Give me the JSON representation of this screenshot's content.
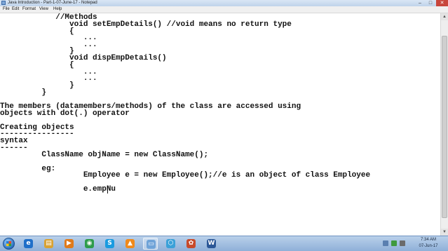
{
  "window": {
    "title": "Java Introduction - Part-1-07-June-17 - Notepad",
    "controls": {
      "minimize": "–",
      "maximize": "□",
      "close": "✕"
    }
  },
  "menu": {
    "items": [
      "File",
      "Edit",
      "Format",
      "View",
      "Help"
    ]
  },
  "editor": {
    "lines": [
      {
        "text": "            //Methods"
      },
      {
        "text": "               void setEmpDetails() //void means no return type"
      },
      {
        "text": "               {"
      },
      {
        "text": "                  ..."
      },
      {
        "text": "                  ..."
      },
      {
        "text": "               }"
      },
      {
        "text": "               void dispEmpDetails()"
      },
      {
        "text": "               {"
      },
      {
        "text": "                  ..."
      },
      {
        "text": "                  ..."
      },
      {
        "text": "               }"
      },
      {
        "text": "         }"
      },
      {
        "text": "The members (datamembers/methods) of the class are accessed using"
      },
      {
        "text": "objects with dot(.) operator"
      },
      {
        "text": ""
      },
      {
        "text": "Creating objects"
      },
      {
        "text": "----------------"
      },
      {
        "text": "syntax"
      },
      {
        "text": "------"
      },
      {
        "text": "         ClassName objName = new ClassName();"
      },
      {
        "text": ""
      },
      {
        "text": "         eg:"
      },
      {
        "text": "                  Employee e = new Employee();//e is an object of class Employee"
      },
      {
        "text": ""
      },
      {
        "text": "                  e.empNu"
      }
    ]
  },
  "scrollbar": {
    "up": "▲",
    "down": "▼"
  },
  "taskbar": {
    "buttons": [
      {
        "icon": "ie-icon",
        "glyph": "e",
        "color": "#1f6fc9"
      },
      {
        "icon": "explorer-icon",
        "glyph": "▤",
        "color": "#d9a233"
      },
      {
        "icon": "media-player-icon",
        "glyph": "▶",
        "color": "#e07a1a"
      },
      {
        "icon": "chrome-icon",
        "glyph": "◉",
        "color": "#2e9c4a"
      },
      {
        "icon": "skype-icon",
        "glyph": "S",
        "color": "#1a9be0"
      },
      {
        "icon": "vlc-icon",
        "glyph": "▲",
        "color": "#f08a1c"
      },
      {
        "icon": "notepad-icon",
        "glyph": "▭",
        "color": "#6fa3d8"
      },
      {
        "icon": "network-icon",
        "glyph": "⬡",
        "color": "#3aa1d8"
      },
      {
        "icon": "tools-icon",
        "glyph": "✿",
        "color": "#c84a2a"
      },
      {
        "icon": "word-icon",
        "glyph": "W",
        "color": "#2b5797"
      }
    ],
    "clock": {
      "time": "7:34 AM",
      "date": "07-Jun-17"
    }
  }
}
